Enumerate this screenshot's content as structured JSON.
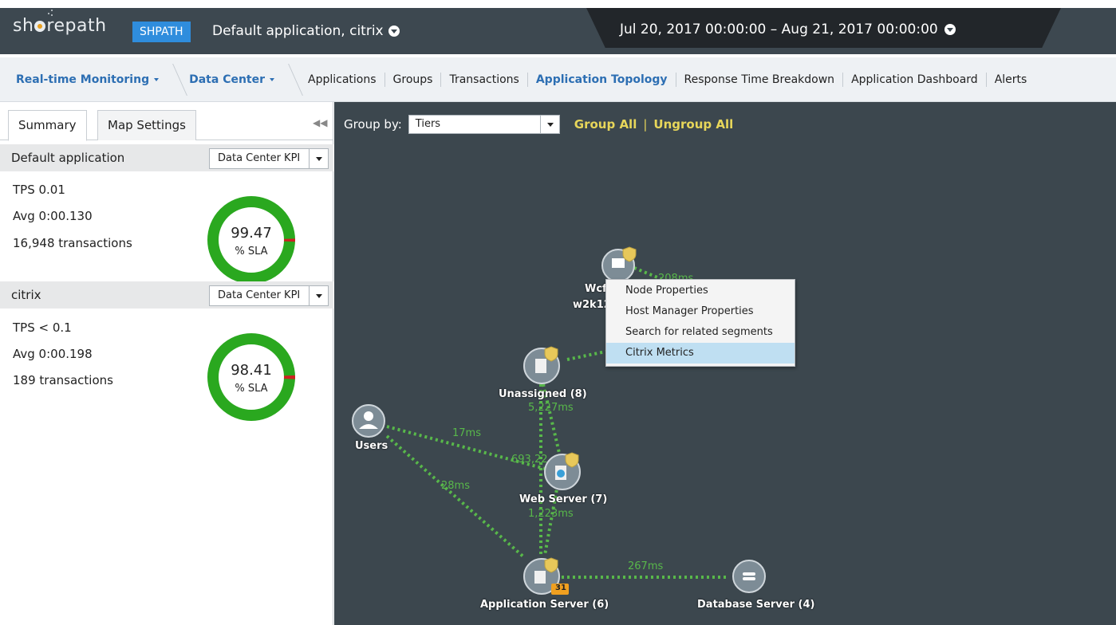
{
  "header": {
    "logo_text_before": "sh",
    "logo_text_after": "repath",
    "app_badge": "SHPATH",
    "app_title": "Default application, citrix",
    "date_range": "Jul 20, 2017  00:00:00 – Aug 21, 2017  00:00:00"
  },
  "nav": {
    "dropdowns": [
      "Real-time Monitoring",
      "Data Center"
    ],
    "tabs": [
      "Applications",
      "Groups",
      "Transactions",
      "Application Topology",
      "Response Time Breakdown",
      "Application Dashboard",
      "Alerts"
    ],
    "active_tab": "Application Topology"
  },
  "left_panel": {
    "tabs": [
      "Summary",
      "Map Settings"
    ],
    "active_tab": "Summary",
    "kpi_cards": [
      {
        "name": "Default application",
        "kpi_select": "Data Center KPI",
        "tps": "TPS 0.01",
        "avg": "Avg 0:00.130",
        "transactions": "16,948 transactions",
        "sla_value": "99.47",
        "sla_label": "% SLA",
        "sla_fraction": 0.9947
      },
      {
        "name": "citrix",
        "kpi_select": "Data Center KPI",
        "tps": "TPS < 0.1",
        "avg": "Avg 0:00.198",
        "transactions": "189 transactions",
        "sla_value": "98.41",
        "sla_label": "% SLA",
        "sla_fraction": 0.9841
      }
    ]
  },
  "map": {
    "group_by_label": "Group by:",
    "group_by_value": "Tiers",
    "group_all": "Group All",
    "separator": "|",
    "ungroup_all": "Ungroup All",
    "nodes": {
      "wcf_line1": "Wcf",
      "wcf_line2": "w2k12",
      "unassigned": "Unassigned (8)",
      "users": "Users",
      "web_server": "Web Server (7)",
      "app_server": "Application Server (6)",
      "db_server": "Database Server (4)",
      "app_server_badge": "31"
    },
    "edges": {
      "wcf_out": "208ms",
      "unassigned_out": "5,227ms",
      "users_web": "17ms",
      "web_in": "693,22",
      "users_app": "28ms",
      "web_out": "1,223ms",
      "app_db": "267ms"
    },
    "context_menu": {
      "items": [
        "Node Properties",
        "Host Manager Properties",
        "Search for related segments",
        "Citrix Metrics"
      ],
      "highlighted": "Citrix Metrics"
    }
  },
  "colors": {
    "header_bg": "#3d4850",
    "accent_blue": "#2f8ddd",
    "sla_green": "#2aa81f",
    "sla_red": "#cc2222",
    "edge_green": "#58b84a",
    "map_bg": "#3c474e",
    "link_yellow": "#e7d65a"
  }
}
